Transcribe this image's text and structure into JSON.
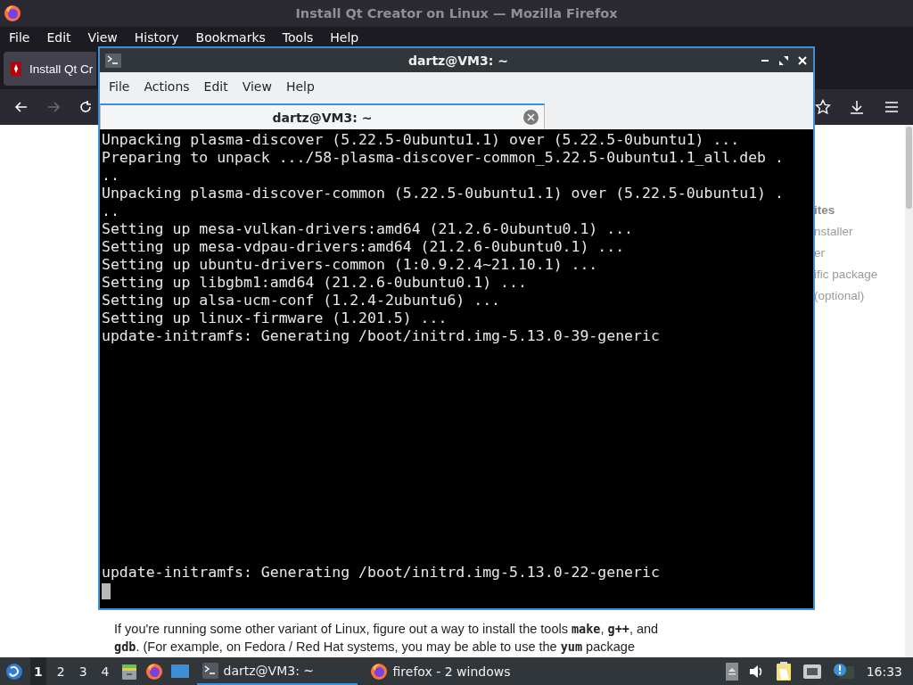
{
  "browser": {
    "title": "Install Qt Creator on Linux — Mozilla Firefox",
    "menu": [
      "File",
      "Edit",
      "View",
      "History",
      "Bookmarks",
      "Tools",
      "Help"
    ],
    "tab": {
      "title": "Install Qt Cr"
    },
    "sidebar": [
      {
        "text": "ites",
        "kind": "heading"
      },
      {
        "text": "nstaller",
        "kind": "link"
      },
      {
        "text": "er",
        "kind": "link"
      },
      {
        "text": "ific package",
        "kind": "link"
      },
      {
        "text": "(optional)",
        "kind": "link"
      }
    ],
    "paragraph": "If you're running some other variant of Linux, figure out a way to install the tools **make**, **g++**, and **gdb**. (For example, on Fedora / Red Hat systems, you may be able to use the **yum** package"
  },
  "terminal": {
    "title": "dartz@VM3: ~",
    "menu": [
      "File",
      "Actions",
      "Edit",
      "View",
      "Help"
    ],
    "tab": {
      "title": "dartz@VM3: ~",
      "selected": true
    },
    "output": [
      "Unpacking plasma-discover (5.22.5-0ubuntu1.1) over (5.22.5-0ubuntu1) ...",
      "Preparing to unpack .../58-plasma-discover-common_5.22.5-0ubuntu1.1_all.deb .",
      "..",
      "Unpacking plasma-discover-common (5.22.5-0ubuntu1.1) over (5.22.5-0ubuntu1) .",
      "..",
      "Setting up mesa-vulkan-drivers:amd64 (21.2.6-0ubuntu0.1) ...",
      "Setting up mesa-vdpau-drivers:amd64 (21.2.6-0ubuntu0.1) ...",
      "Setting up ubuntu-drivers-common (1:0.9.2.4~21.10.1) ...",
      "Setting up libgbm1:amd64 (21.2.6-0ubuntu0.1) ...",
      "Setting up alsa-ucm-conf (1.2.4-2ubuntu6) ...",
      "Setting up linux-firmware (1.201.5) ...",
      "update-initramfs: Generating /boot/initrd.img-5.13.0-39-generic"
    ],
    "output_after": [
      "update-initramfs: Generating /boot/initrd.img-5.13.0-22-generic"
    ]
  },
  "taskbar": {
    "workspaces": [
      {
        "label": "1",
        "selected": true
      },
      {
        "label": "2",
        "selected": false
      },
      {
        "label": "3",
        "selected": false
      },
      {
        "label": "4",
        "selected": false
      }
    ],
    "tasks": [
      {
        "label": "dartz@VM3: ~",
        "kind": "terminal",
        "selected": true
      },
      {
        "label": "firefox - 2 windows",
        "kind": "firefox",
        "selected": false
      }
    ],
    "clock": "16:33"
  }
}
